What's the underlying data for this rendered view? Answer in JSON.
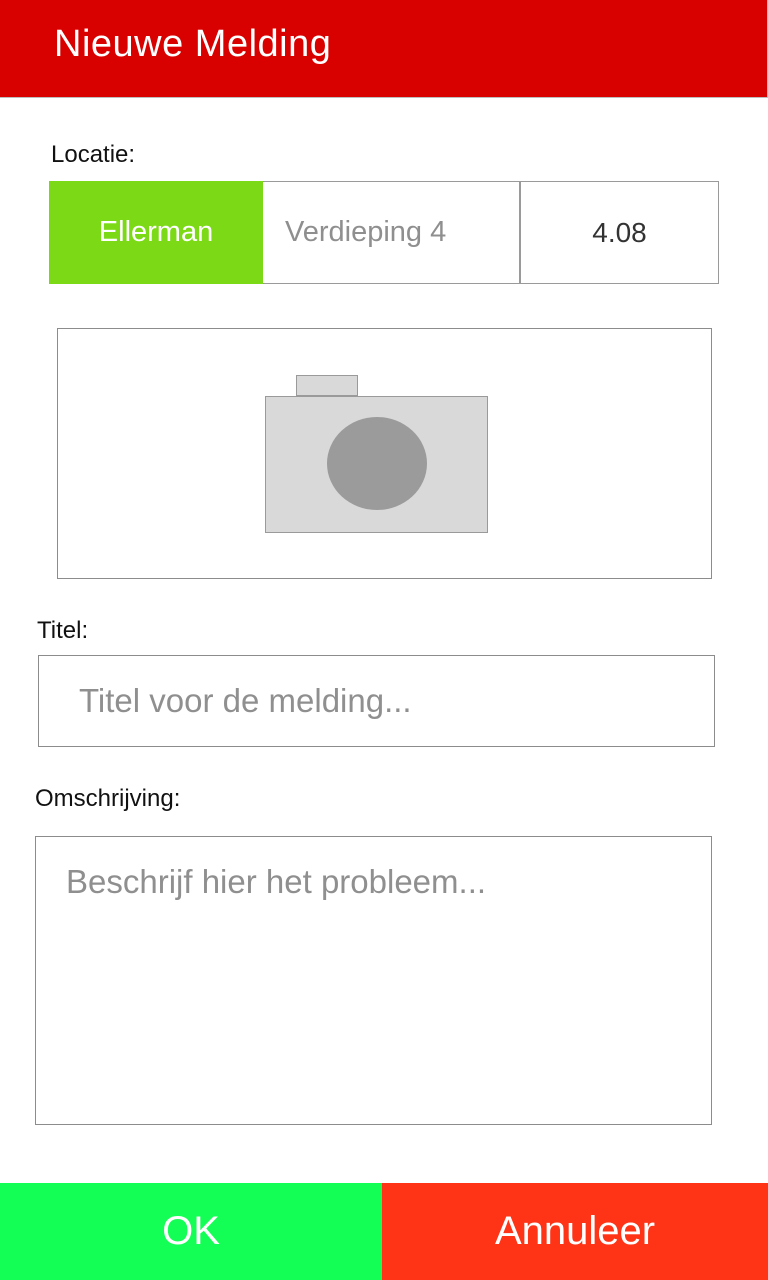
{
  "header": {
    "title": "Nieuwe Melding"
  },
  "location": {
    "label": "Locatie:",
    "building": "Ellerman",
    "floor": "Verdieping 4",
    "room": "4.08"
  },
  "photo": {
    "icon": "camera-icon"
  },
  "title_field": {
    "label": "Titel:",
    "placeholder": "Titel voor de melding..."
  },
  "description_field": {
    "label": "Omschrijving:",
    "placeholder": "Beschrijf hier het probleem..."
  },
  "actions": {
    "ok_label": "OK",
    "cancel_label": "Annuleer"
  },
  "colors": {
    "header_bg": "#d90000",
    "building_selected": "#7cd916",
    "ok_bg": "#14ff55",
    "cancel_bg": "#ff3316"
  }
}
